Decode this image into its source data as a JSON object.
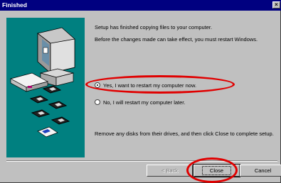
{
  "window": {
    "title": "Finished",
    "close_glyph": "×"
  },
  "content": {
    "line1": "Setup has finished copying files to your computer.",
    "line2": "Before the changes made can take effect, you must restart Windows.",
    "radio_yes": "Yes, I want to restart my computer now.",
    "radio_no": "No, I will restart my computer later.",
    "instruction": "Remove any disks from their drives, and then click Close to complete setup."
  },
  "buttons": {
    "back": "< Back",
    "close": "Close",
    "cancel": "Cancel"
  },
  "state": {
    "selected_option": "yes"
  },
  "colors": {
    "title_bar": "#000080",
    "art_background": "#008080",
    "annotation": "#e00000"
  }
}
